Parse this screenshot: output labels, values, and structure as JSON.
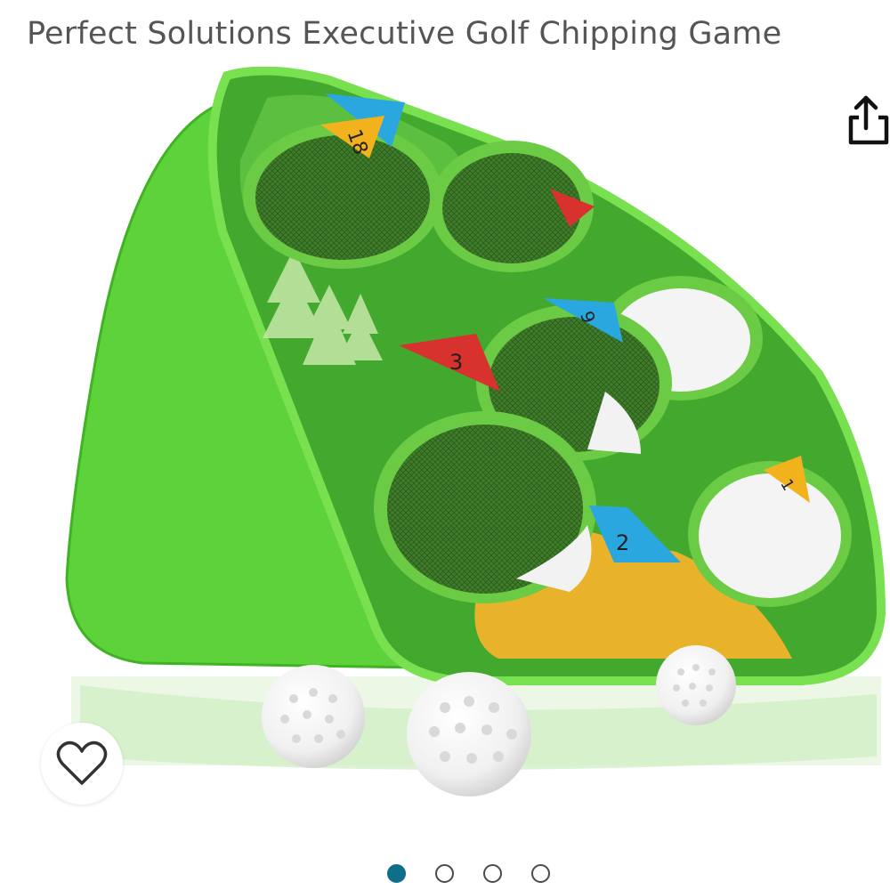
{
  "product": {
    "title": "Perfect Solutions Executive Golf Chipping Game"
  },
  "image": {
    "alt": "Green pop-up golf chipping target with numbered hole flags and three practice balls",
    "flags": [
      "18",
      "9",
      "3",
      "2",
      "1"
    ]
  },
  "actions": {
    "share_icon": "share-icon",
    "wishlist_icon": "heart-icon"
  },
  "carousel": {
    "total": 4,
    "active_index": 0
  },
  "colors": {
    "accent": "#0f6e8c",
    "title_text": "#555555",
    "net_green": "#5cc93b"
  }
}
